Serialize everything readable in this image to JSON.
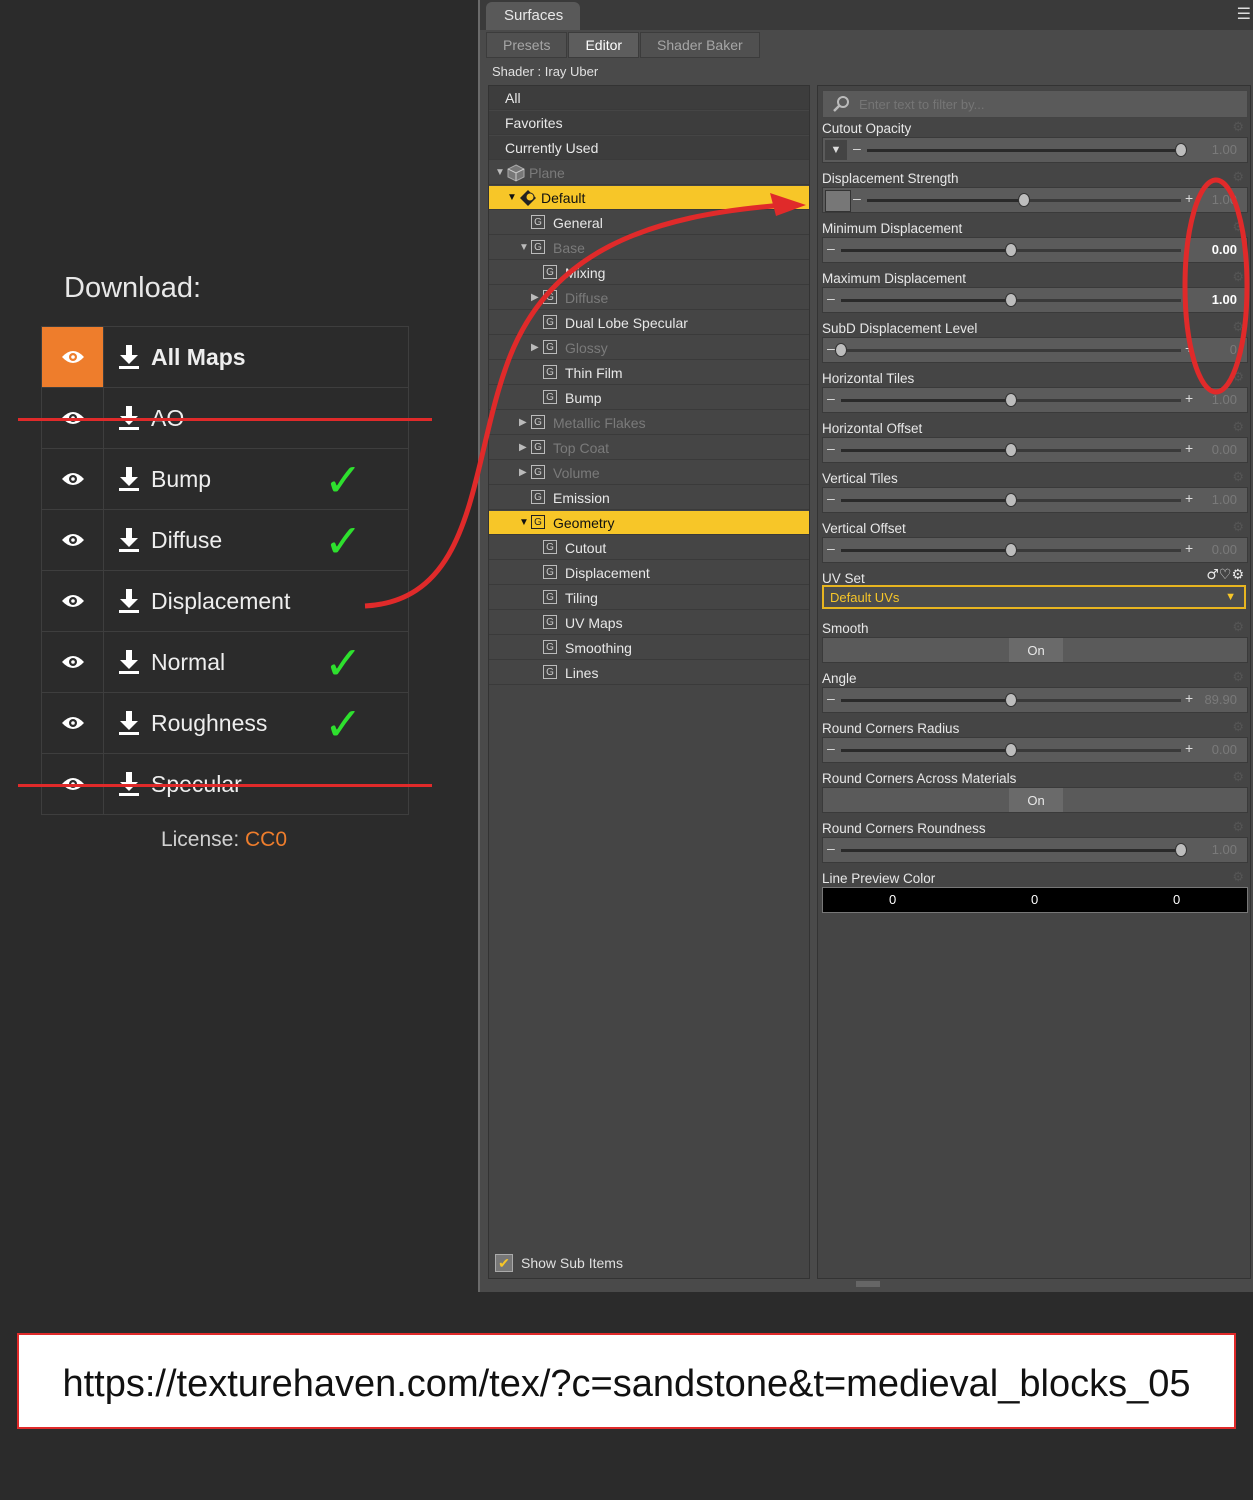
{
  "download": {
    "title": "Download:",
    "items": [
      {
        "label": "All Maps",
        "bold": true,
        "active": true,
        "checked": false,
        "struck": false
      },
      {
        "label": "AO",
        "bold": false,
        "active": false,
        "checked": false,
        "struck": true
      },
      {
        "label": "Bump",
        "bold": false,
        "active": false,
        "checked": true,
        "struck": false
      },
      {
        "label": "Diffuse",
        "bold": false,
        "active": false,
        "checked": true,
        "struck": false
      },
      {
        "label": "Displacement",
        "bold": false,
        "active": false,
        "checked": false,
        "struck": false
      },
      {
        "label": "Normal",
        "bold": false,
        "active": false,
        "checked": true,
        "struck": false
      },
      {
        "label": "Roughness",
        "bold": false,
        "active": false,
        "checked": true,
        "struck": false
      },
      {
        "label": "Specular",
        "bold": false,
        "active": false,
        "checked": false,
        "struck": true
      }
    ],
    "license_label": "License:",
    "license_value": "CC0",
    "check_glyph": "✓"
  },
  "surfaces": {
    "window_title": "Surfaces",
    "tabs": [
      {
        "label": "Presets",
        "active": false
      },
      {
        "label": "Editor",
        "active": true
      },
      {
        "label": "Shader Baker",
        "active": false
      }
    ],
    "shader_line": "Shader : Iray Uber",
    "tree_top": [
      "All",
      "Favorites",
      "Currently Used"
    ],
    "tree": [
      {
        "label": "Plane",
        "level": 0,
        "arrow": "▼",
        "dim": true,
        "sel": false,
        "icon": "cube"
      },
      {
        "label": "Default",
        "level": 1,
        "arrow": "▼",
        "dim": false,
        "sel": true,
        "icon": "material"
      },
      {
        "label": "General",
        "level": 2,
        "arrow": "",
        "dim": false,
        "sel": false,
        "icon": "g"
      },
      {
        "label": "Base",
        "level": 2,
        "arrow": "▼",
        "dim": true,
        "sel": false,
        "icon": "g"
      },
      {
        "label": "Mixing",
        "level": 3,
        "arrow": "",
        "dim": false,
        "sel": false,
        "icon": "g"
      },
      {
        "label": "Diffuse",
        "level": 3,
        "arrow": "▶",
        "dim": true,
        "sel": false,
        "icon": "g"
      },
      {
        "label": "Dual Lobe Specular",
        "level": 3,
        "arrow": "",
        "dim": false,
        "sel": false,
        "icon": "g"
      },
      {
        "label": "Glossy",
        "level": 3,
        "arrow": "▶",
        "dim": true,
        "sel": false,
        "icon": "g"
      },
      {
        "label": "Thin Film",
        "level": 3,
        "arrow": "",
        "dim": false,
        "sel": false,
        "icon": "g"
      },
      {
        "label": "Bump",
        "level": 3,
        "arrow": "",
        "dim": false,
        "sel": false,
        "icon": "g"
      },
      {
        "label": "Metallic Flakes",
        "level": 2,
        "arrow": "▶",
        "dim": true,
        "sel": false,
        "icon": "g"
      },
      {
        "label": "Top Coat",
        "level": 2,
        "arrow": "▶",
        "dim": true,
        "sel": false,
        "icon": "g"
      },
      {
        "label": "Volume",
        "level": 2,
        "arrow": "▶",
        "dim": true,
        "sel": false,
        "icon": "g"
      },
      {
        "label": "Emission",
        "level": 2,
        "arrow": "",
        "dim": false,
        "sel": false,
        "icon": "g"
      },
      {
        "label": "Geometry",
        "level": 2,
        "arrow": "▼",
        "dim": false,
        "sel": true,
        "icon": "g"
      },
      {
        "label": "Cutout",
        "level": 3,
        "arrow": "",
        "dim": false,
        "sel": false,
        "icon": "g"
      },
      {
        "label": "Displacement",
        "level": 3,
        "arrow": "",
        "dim": false,
        "sel": false,
        "icon": "g"
      },
      {
        "label": "Tiling",
        "level": 3,
        "arrow": "",
        "dim": false,
        "sel": false,
        "icon": "g"
      },
      {
        "label": "UV Maps",
        "level": 3,
        "arrow": "",
        "dim": false,
        "sel": false,
        "icon": "g"
      },
      {
        "label": "Smoothing",
        "level": 3,
        "arrow": "",
        "dim": false,
        "sel": false,
        "icon": "g"
      },
      {
        "label": "Lines",
        "level": 3,
        "arrow": "",
        "dim": false,
        "sel": false,
        "icon": "g"
      }
    ],
    "group_glyph": "G",
    "show_sub_items": "Show Sub Items",
    "filter_placeholder": "Enter text to filter by...",
    "properties": [
      {
        "label": "Cutout Opacity",
        "kind": "slider",
        "value": "1.00",
        "fraction": 1.0,
        "lead": "dropdown",
        "plus": false,
        "bright": false
      },
      {
        "label": "Displacement Strength",
        "kind": "slider",
        "value": "1.00",
        "fraction": 0.5,
        "lead": "thumb",
        "plus": true,
        "bright": false
      },
      {
        "label": "Minimum Displacement",
        "kind": "slider",
        "value": "0.00",
        "fraction": 0.5,
        "lead": "minus",
        "plus": false,
        "bright": true
      },
      {
        "label": "Maximum Displacement",
        "kind": "slider",
        "value": "1.00",
        "fraction": 0.5,
        "lead": "minus",
        "plus": false,
        "bright": true
      },
      {
        "label": "SubD Displacement Level",
        "kind": "slider",
        "value": "0",
        "fraction": 0.0,
        "lead": "minus",
        "plus": true,
        "bright": false
      },
      {
        "label": "Horizontal Tiles",
        "kind": "slider",
        "value": "1.00",
        "fraction": 0.5,
        "lead": "minus",
        "plus": true,
        "bright": false
      },
      {
        "label": "Horizontal Offset",
        "kind": "slider",
        "value": "0.00",
        "fraction": 0.5,
        "lead": "minus",
        "plus": true,
        "bright": false
      },
      {
        "label": "Vertical Tiles",
        "kind": "slider",
        "value": "1.00",
        "fraction": 0.5,
        "lead": "minus",
        "plus": true,
        "bright": false
      },
      {
        "label": "Vertical Offset",
        "kind": "slider",
        "value": "0.00",
        "fraction": 0.5,
        "lead": "minus",
        "plus": true,
        "bright": false
      },
      {
        "label": "UV Set",
        "kind": "uvset",
        "value": "Default UVs"
      },
      {
        "label": "Smooth",
        "kind": "toggle",
        "value": "On"
      },
      {
        "label": "Angle",
        "kind": "slider",
        "value": "89.90",
        "fraction": 0.5,
        "lead": "minus",
        "plus": true,
        "bright": false
      },
      {
        "label": "Round Corners Radius",
        "kind": "slider",
        "value": "0.00",
        "fraction": 0.5,
        "lead": "minus",
        "plus": true,
        "bright": false
      },
      {
        "label": "Round Corners Across Materials",
        "kind": "toggle",
        "value": "On"
      },
      {
        "label": "Round Corners Roundness",
        "kind": "slider",
        "value": "1.00",
        "fraction": 1.0,
        "lead": "minus",
        "plus": false,
        "bright": false
      },
      {
        "label": "Line Preview Color",
        "kind": "color",
        "value": [
          "0",
          "0",
          "0"
        ]
      }
    ]
  },
  "url": "https://texturehaven.com/tex/?c=sandstone&t=medieval_blocks_05",
  "colors": {
    "accent_orange": "#ee7d2c",
    "highlight_yellow": "#f7c628",
    "annotation_red": "#e02a2a",
    "check_green": "#2ee02e"
  }
}
